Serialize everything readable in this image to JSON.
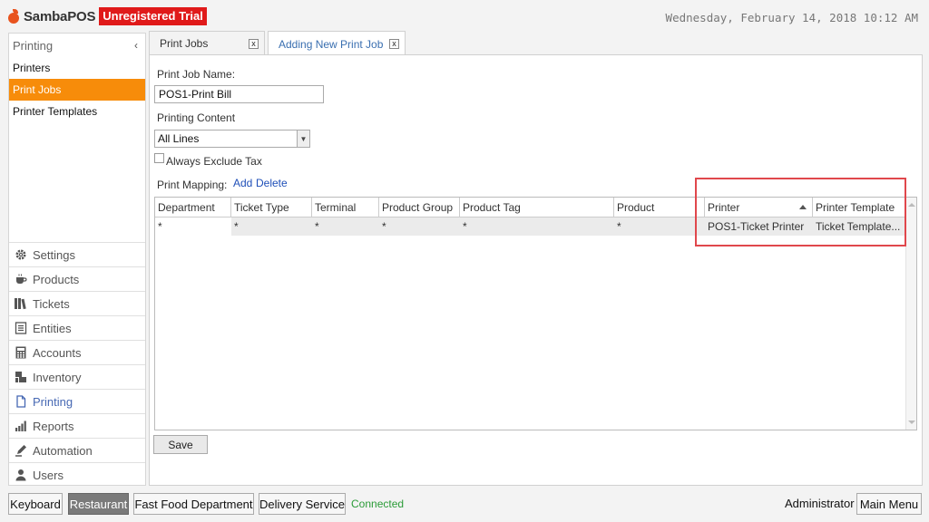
{
  "header": {
    "logo_text": "SambaPOS",
    "badge": "Unregistered Trial",
    "datetime": "Wednesday, February 14, 2018 10:12 AM",
    "brand_color": "#e8531e",
    "badge_color": "#e01a1a"
  },
  "sidebar": {
    "section_title": "Printing",
    "collapse_icon": "chevron-left-icon",
    "sub_items": [
      {
        "label": "Printers",
        "active": false
      },
      {
        "label": "Print Jobs",
        "active": true
      },
      {
        "label": "Printer Templates",
        "active": false
      }
    ],
    "nav": [
      {
        "label": "Settings",
        "icon": "gear-icon"
      },
      {
        "label": "Products",
        "icon": "coffee-cup-icon"
      },
      {
        "label": "Tickets",
        "icon": "books-icon"
      },
      {
        "label": "Entities",
        "icon": "list-icon"
      },
      {
        "label": "Accounts",
        "icon": "calculator-icon"
      },
      {
        "label": "Inventory",
        "icon": "inventory-icon"
      },
      {
        "label": "Printing",
        "icon": "document-icon",
        "active": true
      },
      {
        "label": "Reports",
        "icon": "bar-chart-icon"
      },
      {
        "label": "Automation",
        "icon": "pen-icon"
      },
      {
        "label": "Users",
        "icon": "user-icon"
      }
    ],
    "active_color": "#f78c0a"
  },
  "tabs": [
    {
      "label": "Print Jobs",
      "close": "x"
    },
    {
      "label": "Adding New Print Job",
      "close": "x"
    }
  ],
  "form": {
    "name_label": "Print Job Name:",
    "name_value": "POS1-Print Bill",
    "content_label": "Printing Content",
    "content_value": "All Lines",
    "exclude_tax_label": "Always Exclude Tax",
    "exclude_tax_checked": false,
    "mapping_label": "Print Mapping:",
    "add_link": "Add",
    "delete_link": "Delete",
    "save_label": "Save"
  },
  "grid": {
    "columns": [
      "Department",
      "Ticket Type",
      "Terminal",
      "Product Group",
      "Product Tag",
      "Product",
      "Printer",
      "Printer Template"
    ],
    "rows": [
      [
        "*",
        "*",
        "*",
        "*",
        "*",
        "*",
        "POS1-Ticket Printer",
        "Ticket Template..."
      ]
    ],
    "highlight_color": "#e0474c"
  },
  "footer": {
    "buttons": [
      "Keyboard",
      "Restaurant",
      "Fast Food Department",
      "Delivery Service"
    ],
    "selected": "Restaurant",
    "status": "Connected",
    "user": "Administrator",
    "main_menu": "Main Menu"
  }
}
